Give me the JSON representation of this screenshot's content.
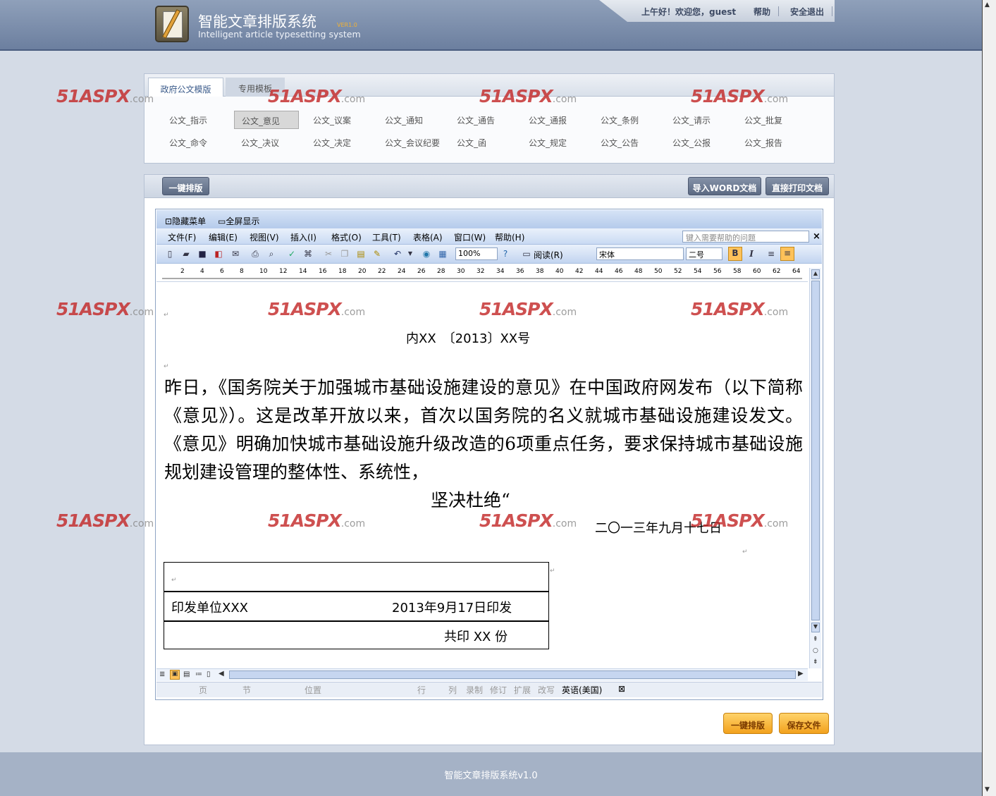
{
  "header": {
    "title_cn": "智能文章排版系统",
    "version": "VER1.0",
    "title_en": "Intelligent article typesetting system",
    "welcome": "上午好！欢迎您，guest",
    "help": "帮助",
    "logout": "安全退出"
  },
  "templates": {
    "tabs": [
      "政府公文模版",
      "专用模板"
    ],
    "row1": [
      "公文_指示",
      "公文_意见",
      "公文_议案",
      "公文_通知",
      "公文_通告",
      "公文_通报",
      "公文_条例",
      "公文_请示",
      "公文_批复"
    ],
    "row2": [
      "公文_命令",
      "公文_决议",
      "公文_决定",
      "公文_会议纪要",
      "公文_函",
      "公文_规定",
      "公文_公告",
      "公文_公报",
      "公文_报告"
    ]
  },
  "actions": {
    "one_click_format": "一键排版",
    "import_word": "导入WORD文档",
    "print_direct": "直接打印文档",
    "save_file": "保存文件"
  },
  "word": {
    "hide_menu": "隐藏菜单",
    "fullscreen": "全屏显示",
    "menu": [
      "文件(F)",
      "编辑(E)",
      "视图(V)",
      "插入(I)",
      "格式(O)",
      "工具(T)",
      "表格(A)",
      "窗口(W)",
      "帮助(H)"
    ],
    "help_placeholder": "键入需要帮助的问题",
    "zoom": "100%",
    "read_mode": "阅读(R)",
    "font_name": "宋体",
    "font_size": "二号",
    "ruler_ticks": [
      "2",
      "4",
      "6",
      "8",
      "10",
      "12",
      "14",
      "16",
      "18",
      "20",
      "22",
      "24",
      "26",
      "28",
      "30",
      "32",
      "34",
      "36",
      "38",
      "40",
      "42",
      "44",
      "46",
      "48",
      "50",
      "52",
      "54",
      "56",
      "58",
      "60",
      "62",
      "64"
    ],
    "status": {
      "page": "页",
      "section": "节",
      "position": "位置",
      "line": "行",
      "column": "列",
      "record": "录制",
      "revise": "修订",
      "extend": "扩展",
      "overwrite": "改写",
      "language": "英语(美国)"
    }
  },
  "document": {
    "doc_number": "内XX　〔2013〕XX号",
    "body": "昨日，《国务院关于加强城市基础设施建设的意见》在中国政府网发布（以下简称《意见》）。这是改革开放以来，首次以国务院的名义就城市基础设施建设发文。《意见》明确加快城市基础设施升级改造的6项重点任务，要求保持城市基础设施规划建设管理的整体性、系统性，",
    "body_last": "坚决杜绝“",
    "date": "二〇一三年九月十七日",
    "issuer": "印发单位XXX",
    "issue_date": "2013年9月17日印发",
    "copies": "共印 XX 份"
  },
  "watermark": {
    "brand": "51ASPX",
    "suffix": ".com"
  },
  "footer": {
    "text": "智能文章排版系统v1.0"
  }
}
